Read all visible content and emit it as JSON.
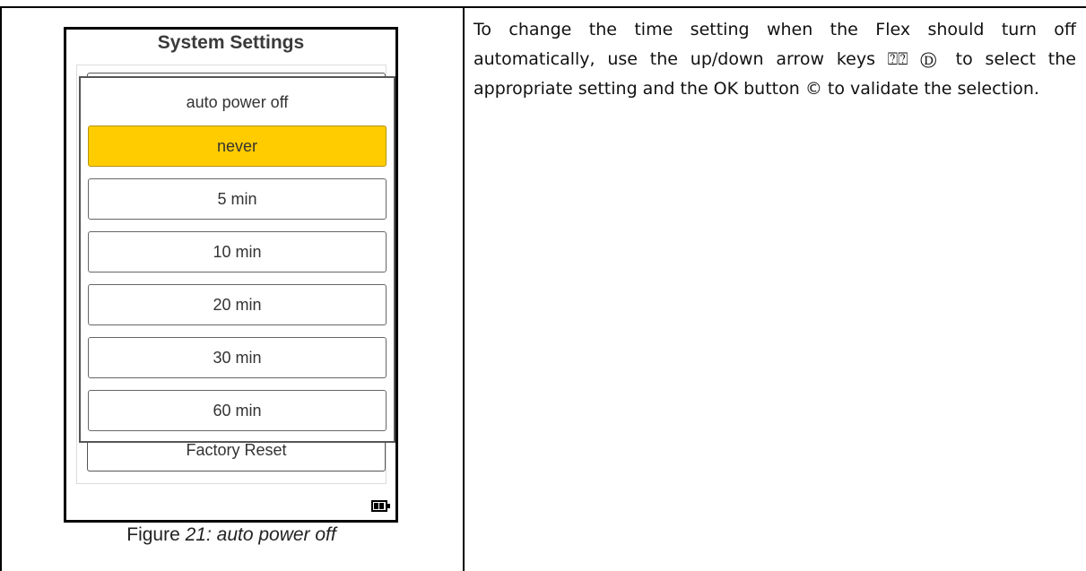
{
  "device": {
    "title": "System Settings",
    "background_row_label": "Factory Reset",
    "popup": {
      "title": "auto power off",
      "options": [
        {
          "label": "never",
          "selected": true
        },
        {
          "label": "5 min",
          "selected": false
        },
        {
          "label": "10 min",
          "selected": false
        },
        {
          "label": "20 min",
          "selected": false
        },
        {
          "label": "30 min",
          "selected": false
        },
        {
          "label": "60 min",
          "selected": false
        }
      ]
    },
    "battery_icon": "battery-icon",
    "highlight_color": "#ffcc00"
  },
  "caption": {
    "prefix": "Figure ",
    "italic": "21: auto power off"
  },
  "instructions": {
    "text": "To change the time setting when the Flex should turn off automatically, use the up/down arrow keys ⍰⍰ Ⓓ to select the appropriate setting and the OK button © to validate the selection."
  }
}
